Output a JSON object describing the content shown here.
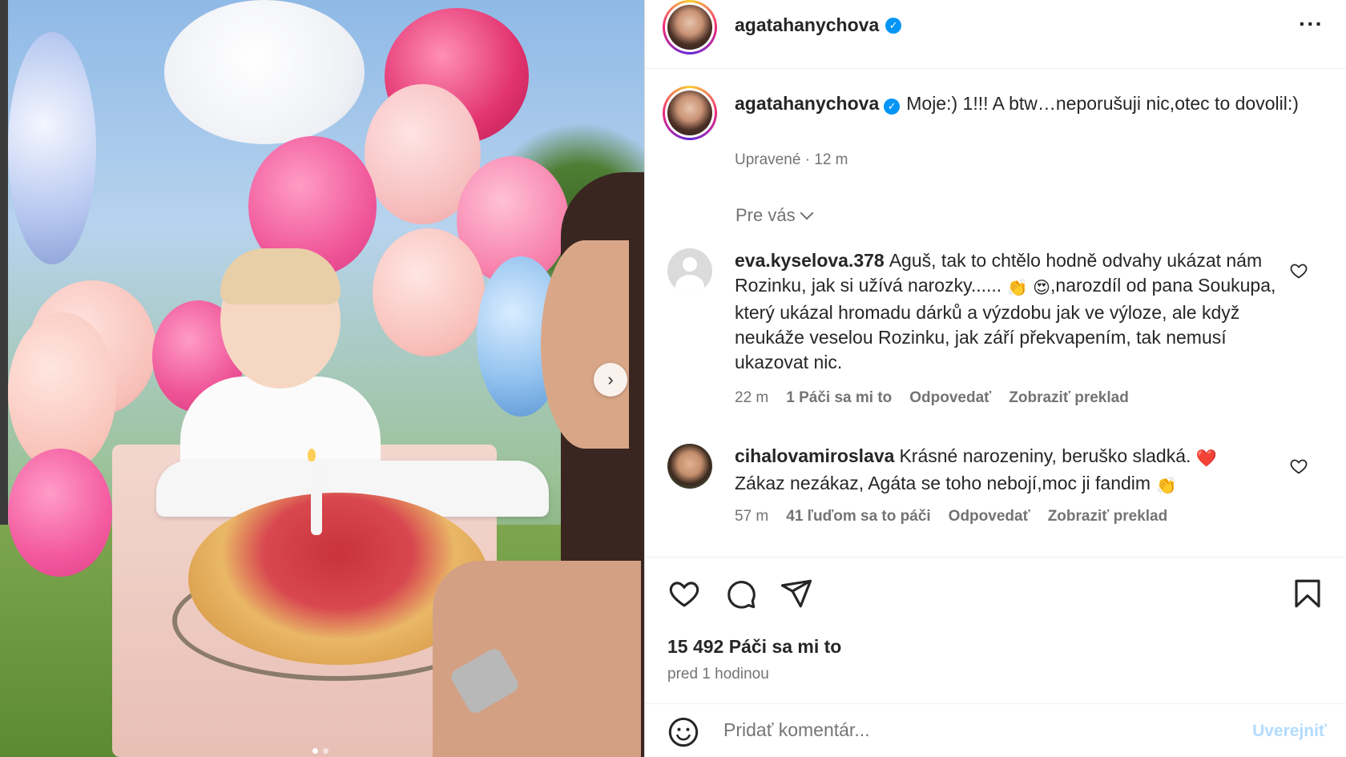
{
  "post": {
    "author": "agatahanychova",
    "caption": "Moje:) 1!!! A btw…neporušuji nic,otec to dovolil:)",
    "edited_label": "Upravené · 12 m"
  },
  "filter": {
    "label": "Pre vás"
  },
  "comments": [
    {
      "username": "eva.kyselova.378",
      "text_part1": "Aguš, tak to chtělo hodně odvahy ukázat nám Rozinku, jak si užívá narozky......",
      "emoji1": "👏",
      "emoji2": "😍",
      "text_part2": ",narozdíl od pana Soukupa, který ukázal hromadu dárků a výzdobu jak ve výloze, ale když neukáže veselou Rozinku, jak září překvapením, tak nemusí ukazovat nic.",
      "time": "22 m",
      "likes": "1 Páči sa mi to",
      "reply": "Odpovedať",
      "translate": "Zobraziť preklad"
    },
    {
      "username": "cihalovamiroslava",
      "text_part1": "Krásné narozeniny, beruško sladká.",
      "emoji1": "❤️",
      "text_part2": "Zákaz nezákaz, Agáta se toho nebojí,moc ji fandim",
      "emoji2": "👏",
      "time": "57 m",
      "likes": "41 ľuďom sa to páči",
      "reply": "Odpovedať",
      "translate": "Zobraziť preklad"
    }
  ],
  "stats": {
    "likes": "15 492 Páči sa mi to",
    "posted": "pred 1 hodinou"
  },
  "add_comment": {
    "placeholder": "Pridať komentár...",
    "post_label": "Uverejniť"
  },
  "carousel": {
    "total": 2,
    "active_index": 0
  },
  "colors": {
    "verified": "#0095f6",
    "secondary_text": "#737373",
    "post_disabled": "#b3dbff",
    "heart_red": "#ed4956"
  }
}
